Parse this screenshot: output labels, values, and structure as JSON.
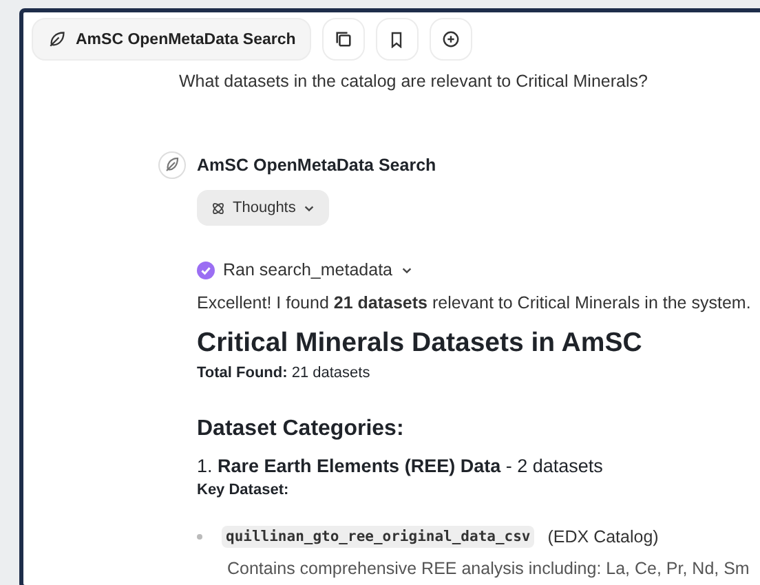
{
  "toolbar": {
    "agent_label": "AmSC OpenMetaData Search"
  },
  "user_message": "What datasets in the catalog are relevant to Critical Minerals?",
  "response": {
    "agent_name": "AmSC OpenMetaData Search",
    "thoughts": {
      "label": "Thoughts",
      "expanded": false
    },
    "tool_call": {
      "label": "Ran search_metadata",
      "done": true,
      "expanded": false
    },
    "intro": "Excellent! I found **21 datasets** relevant to Critical Minerals in the system.",
    "heading": "Critical Minerals Datasets in AmSC",
    "total": "**Total Found:** 21 datasets",
    "section": "Dataset Categories:",
    "category": "1. **Rare Earth Elements (REE) Data** - 2 datasets",
    "key_label": "Key Dataset:",
    "items": [
      {
        "code": "quillinan_gto_ree_original_data_csv",
        "text": " (EDX Catalog)"
      }
    ],
    "sub_item": "Contains comprehensive REE analysis including: La, Ce, Pr, Nd, Sm"
  }
}
